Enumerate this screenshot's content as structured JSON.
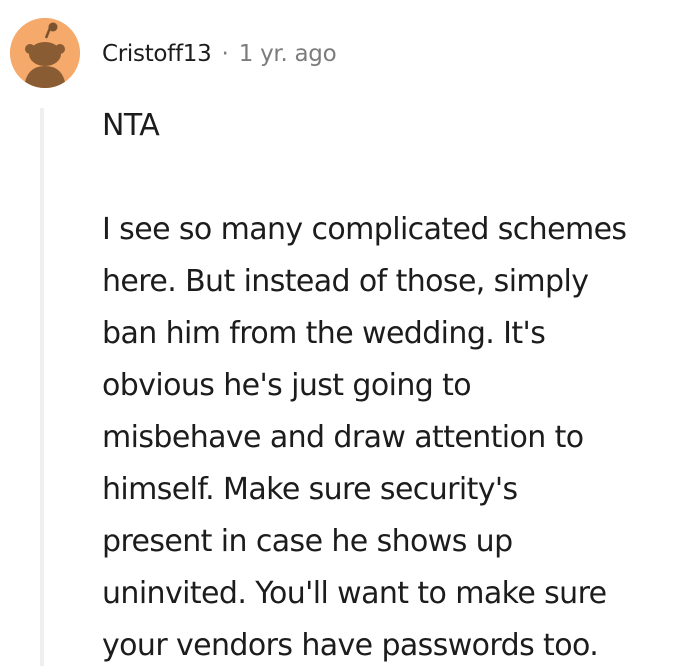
{
  "comment": {
    "author": "Cristoff13",
    "separator": "·",
    "timestamp": "1 yr. ago",
    "avatar_icon": "snoo-avatar-icon",
    "avatar_color": "#f5a96a",
    "body": {
      "verdict": "NTA",
      "lines": [
        "I see so many complicated schemes",
        "here. But instead of those, simply",
        "ban him from the wedding. It's",
        "obvious he's just going to",
        "misbehave and draw attention to",
        "himself. Make sure security's",
        "present in case he shows up",
        "uninvited. You'll want to make sure",
        "your vendors have passwords too."
      ]
    }
  }
}
